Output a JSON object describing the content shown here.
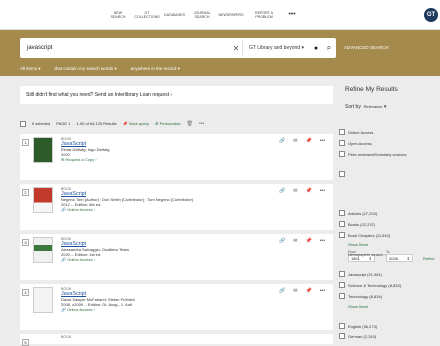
{
  "nav": [
    "NEW SEARCH",
    "GT COLLECTIONS",
    "DATABASES",
    "JOURNAL SEARCH",
    "NEWSPAPERS",
    "REPORT A PROBLEM",
    "•••"
  ],
  "avatar": "GT",
  "search": {
    "query": "javascript",
    "scope": "GT Library and beyond",
    "advanced": "ADVANCED SEARCH"
  },
  "filters": [
    "All items",
    "that contain my search words",
    "anywhere in the record"
  ],
  "ill": "Still didn't find what you need? Send an Interlibrary Loan request",
  "toolbar": {
    "selected": "0 selected",
    "page": "PAGE 1",
    "range": "1-50 of 64,125 Results",
    "save": "Save query",
    "personalize": "Personalize"
  },
  "results": [
    {
      "n": "1",
      "type": "BOOK",
      "title": "JavaScript",
      "authors": "Elmar Dellwig; Ingo Dellwig",
      "year": "2002",
      "action": "Request a Copy"
    },
    {
      "n": "2",
      "type": "BOOK",
      "title": "JavaScript",
      "authors": "Negrino Tom [Author] ; Dori Smith [Contributor] ; Tom Negrino [Contributor]",
      "year": "2012 -- Edition: 8th ed.",
      "action": "Online Access"
    },
    {
      "n": "3",
      "type": "BOOK",
      "title": "JavaScript",
      "authors": "Alessandra Salvaggio; Gualtiero Testa",
      "year": "2020 -- Edition: 1st ed.",
      "action": "Online Access"
    },
    {
      "n": "4",
      "type": "BOOK",
      "title": "JavaScript",
      "authors": "David Sawyer McFarland; Stefan Fröhlich",
      "year": "2008, c2009 -- Edition: Dt. Ausg., 1. Aufl.",
      "action": "Online Access"
    },
    {
      "n": "5",
      "type": "BOOK",
      "title": "",
      "authors": "",
      "year": "",
      "action": ""
    }
  ],
  "sidebar": {
    "title": "Refine My Results",
    "sort_label": "Sort by",
    "sort_value": "Relevance",
    "availability": [
      "Online Access",
      "Open Access",
      "Peer-reviewed/Scholarly sources"
    ],
    "from_label": "From",
    "to_label": "To",
    "from": "1801",
    "to": "2026",
    "refine": "Refine",
    "types": [
      "Articles (27,220)",
      "Books (22,237)",
      "Book Chapters (11,642)"
    ],
    "show_more": "Show More",
    "newspapers": "Newspapers search",
    "subjects": [
      "Javascript (21,961)",
      "Science & Technology (8,833)",
      "Technology (8,834)"
    ],
    "show_more2": "Show More",
    "languages": [
      "English (36,273)",
      "German (2,310)"
    ]
  }
}
